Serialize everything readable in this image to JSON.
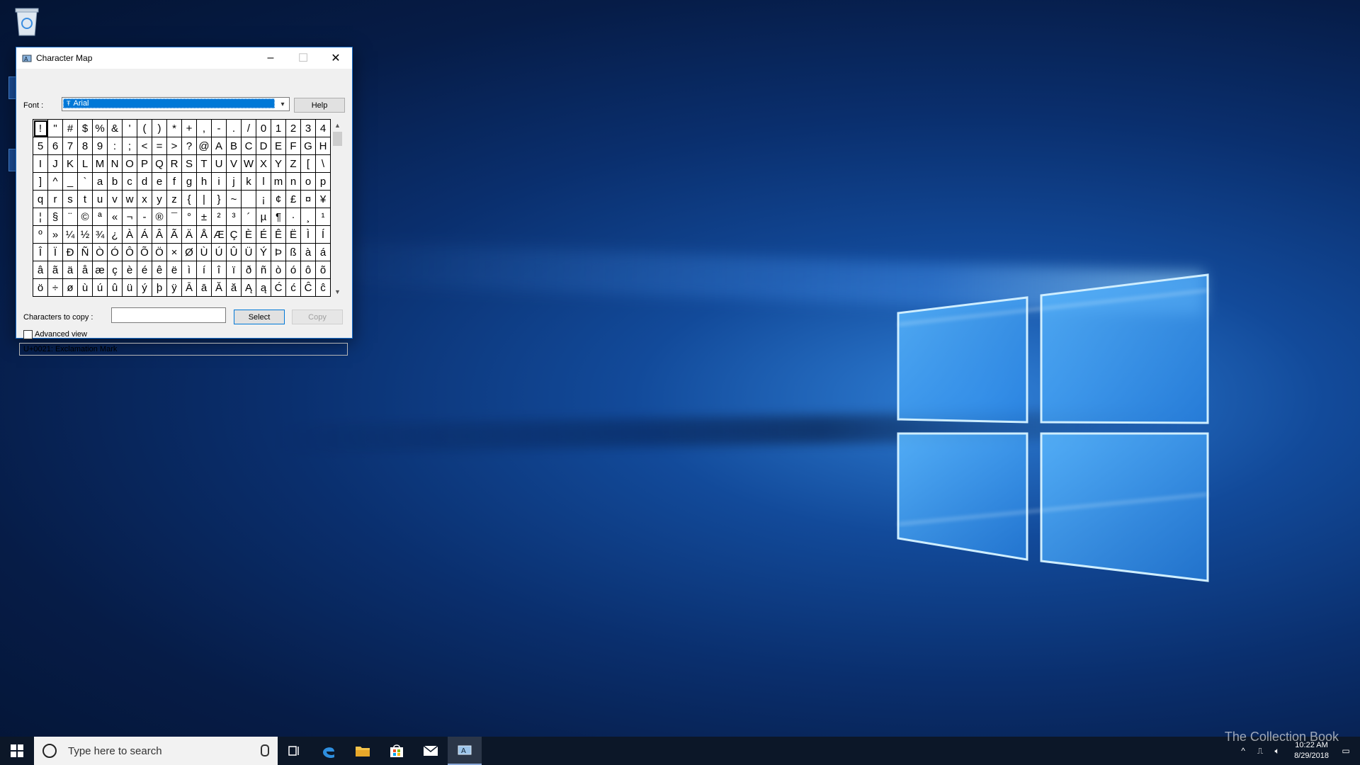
{
  "desktop": {
    "icons": [
      {
        "label": "Recycle Bin",
        "icon": "recycle-bin-icon"
      }
    ]
  },
  "window": {
    "title": "Character Map",
    "controls": {
      "minimize": "–",
      "maximize": "☐",
      "close": "✕"
    },
    "font_label": "Font :",
    "font_value": "Arial",
    "font_type_icon": "Ŧ",
    "help_label": "Help",
    "characters": [
      [
        "!",
        "\"",
        "#",
        "$",
        "%",
        "&",
        "'",
        "(",
        ")",
        "*",
        "+",
        ",",
        "-",
        ".",
        "/",
        "0",
        "1",
        "2",
        "3",
        "4"
      ],
      [
        "5",
        "6",
        "7",
        "8",
        "9",
        ":",
        ";",
        "<",
        "=",
        ">",
        "?",
        "@",
        "A",
        "B",
        "C",
        "D",
        "E",
        "F",
        "G",
        "H"
      ],
      [
        "I",
        "J",
        "K",
        "L",
        "M",
        "N",
        "O",
        "P",
        "Q",
        "R",
        "S",
        "T",
        "U",
        "V",
        "W",
        "X",
        "Y",
        "Z",
        "[",
        "\\"
      ],
      [
        "]",
        "^",
        "_",
        "`",
        "a",
        "b",
        "c",
        "d",
        "e",
        "f",
        "g",
        "h",
        "i",
        "j",
        "k",
        "l",
        "m",
        "n",
        "o",
        "p"
      ],
      [
        "q",
        "r",
        "s",
        "t",
        "u",
        "v",
        "w",
        "x",
        "y",
        "z",
        "{",
        "|",
        "}",
        "~",
        " ",
        "¡",
        "¢",
        "£",
        "¤",
        "¥"
      ],
      [
        "¦",
        "§",
        "¨",
        "©",
        "ª",
        "«",
        "¬",
        "-",
        "®",
        "¯",
        "°",
        "±",
        "²",
        "³",
        "´",
        "µ",
        "¶",
        "·",
        "¸",
        "¹"
      ],
      [
        "º",
        "»",
        "¼",
        "½",
        "¾",
        "¿",
        "À",
        "Á",
        "Â",
        "Ã",
        "Ä",
        "Å",
        "Æ",
        "Ç",
        "È",
        "É",
        "Ê",
        "Ë",
        "Ì",
        "Í"
      ],
      [
        "Î",
        "Ï",
        "Ð",
        "Ñ",
        "Ò",
        "Ó",
        "Ô",
        "Õ",
        "Ö",
        "×",
        "Ø",
        "Ù",
        "Ú",
        "Û",
        "Ü",
        "Ý",
        "Þ",
        "ß",
        "à",
        "á"
      ],
      [
        "â",
        "ã",
        "ä",
        "å",
        "æ",
        "ç",
        "è",
        "é",
        "ê",
        "ë",
        "ì",
        "í",
        "î",
        "ï",
        "ð",
        "ñ",
        "ò",
        "ó",
        "ô",
        "õ"
      ],
      [
        "ö",
        "÷",
        "ø",
        "ù",
        "ú",
        "û",
        "ü",
        "ý",
        "þ",
        "ÿ",
        "Ā",
        "ā",
        "Ă",
        "ă",
        "Ą",
        "ą",
        "Ć",
        "ć",
        "Ĉ",
        "ĉ"
      ]
    ],
    "selected_char": "!",
    "copy_label": "Characters to copy :",
    "copy_value": "",
    "select_label": "Select",
    "copy_button_label": "Copy",
    "advanced_view_label": "Advanced view",
    "advanced_view_checked": false,
    "status": "U+0021: Exclamation Mark"
  },
  "taskbar": {
    "search_placeholder": "Type here to search",
    "apps": [
      "task-view-icon",
      "edge-icon",
      "file-explorer-icon",
      "store-icon",
      "mail-icon",
      "character-map-icon"
    ],
    "active_app": "character-map-icon",
    "time": "10:22 AM",
    "date": "8/29/2018",
    "watermark": "The Collection Book"
  },
  "colors": {
    "accent": "#0078d7",
    "taskbar": "#0c1728",
    "window_border": "#1a6ec8"
  }
}
